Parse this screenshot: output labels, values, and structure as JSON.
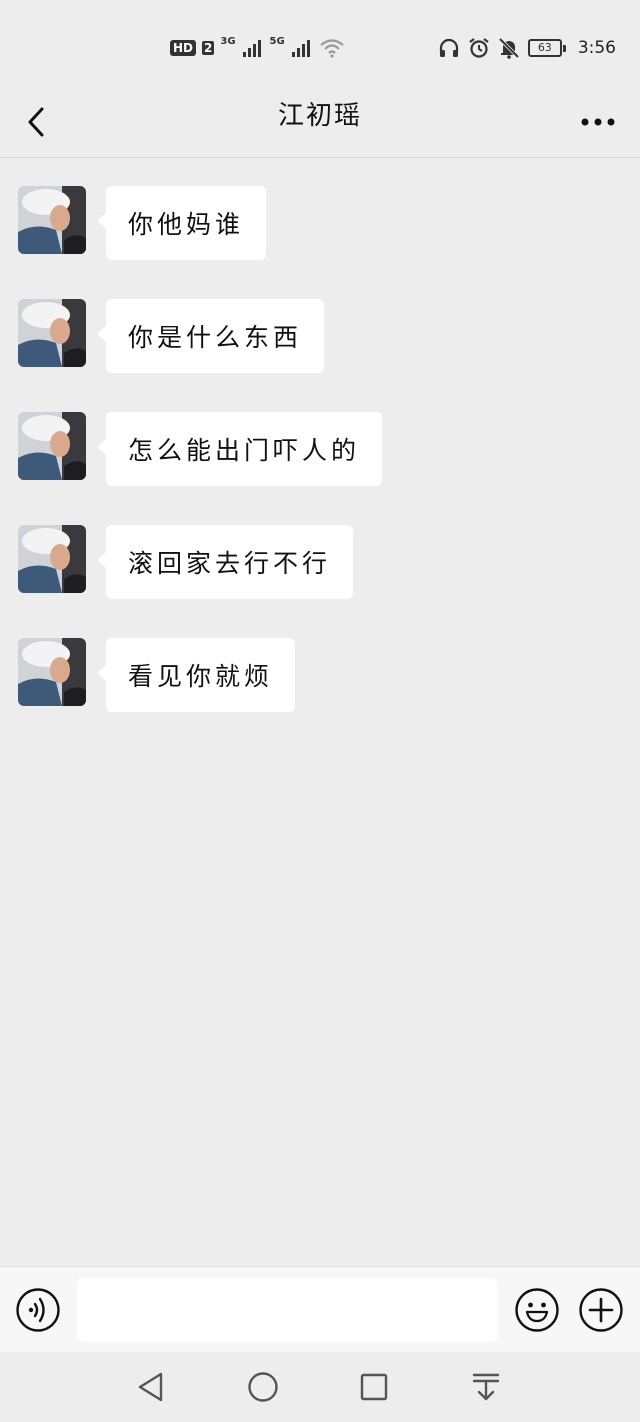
{
  "status_bar": {
    "hd": "HD",
    "sim": "2",
    "net1": "3G",
    "net2": "5G",
    "battery": "63",
    "time": "3:56",
    "icons": [
      "signal-icon",
      "wifi-icon",
      "headphones-icon",
      "alarm-icon",
      "mute-bell-icon",
      "battery-icon"
    ]
  },
  "header": {
    "title": "江初瑶",
    "back_icon": "chevron-left-icon",
    "more_icon": "more-horizontal-icon"
  },
  "messages": [
    {
      "sender": "江初瑶",
      "text": "你他妈谁"
    },
    {
      "sender": "江初瑶",
      "text": "你是什么东西"
    },
    {
      "sender": "江初瑶",
      "text": "怎么能出门吓人的"
    },
    {
      "sender": "江初瑶",
      "text": "滚回家去行不行"
    },
    {
      "sender": "江初瑶",
      "text": "看见你就烦"
    }
  ],
  "input_bar": {
    "value": "",
    "placeholder": "",
    "voice_icon": "voice-icon",
    "emoji_icon": "emoji-icon",
    "plus_icon": "plus-icon"
  },
  "nav_bar": {
    "icons": [
      "back-triangle-icon",
      "home-circle-icon",
      "recents-square-icon",
      "notification-pulldown-icon"
    ]
  },
  "colors": {
    "background": "#ededed",
    "bubble": "#ffffff",
    "text": "#111111",
    "icon": "#222222"
  }
}
